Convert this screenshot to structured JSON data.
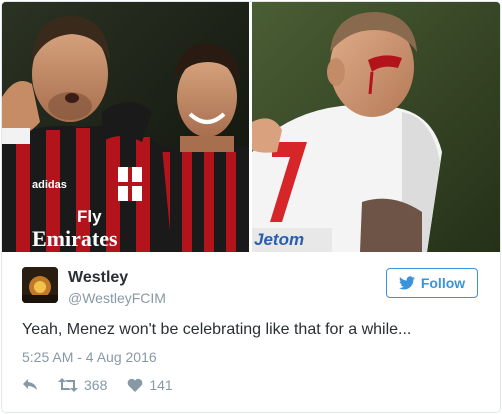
{
  "tweet": {
    "display_name": "Westley",
    "handle": "@WestleyFCIM",
    "text": "Yeah, Menez won't be celebrating like that for a while...",
    "timestamp": "5:25 AM - 4 Aug 2016",
    "follow_label": "Follow",
    "retweet_count": "368",
    "like_count": "141"
  },
  "media": {
    "left_shirt_text_1": "Fly",
    "left_shirt_text_2": "Emirates",
    "left_brand": "adidas",
    "right_shirt_number": "7",
    "right_sponsor_text": "Jetom"
  },
  "icons": {
    "follow": "twitter-bird-icon",
    "reply": "reply-icon",
    "retweet": "retweet-icon",
    "like": "heart-icon"
  },
  "colors": {
    "accent": "#3b94d9",
    "text": "#292f33",
    "muted": "#8899a6",
    "border": "#e1e8ed"
  }
}
